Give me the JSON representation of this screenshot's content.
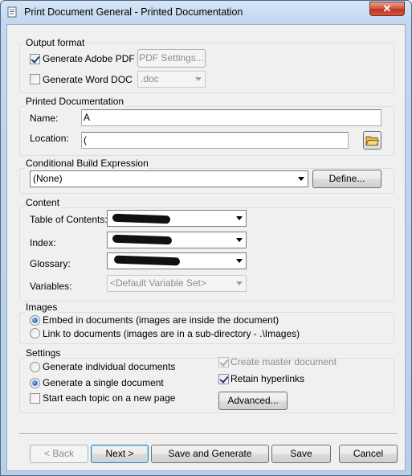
{
  "window": {
    "title": "Print Document General - Printed Documentation",
    "close_glyph": "✕"
  },
  "output_format": {
    "legend": "Output format",
    "generate_pdf_label": "Generate Adobe PDF",
    "generate_pdf_checked": true,
    "pdf_settings_label": "PDF Settings...",
    "generate_word_label": "Generate Word DOC",
    "generate_word_checked": false,
    "word_format_value": ".doc"
  },
  "printed_documentation": {
    "legend": "Printed Documentation",
    "name_label": "Name:",
    "name_value": "A",
    "location_label": "Location:",
    "location_value": "("
  },
  "conditional_build": {
    "legend": "Conditional Build Expression",
    "expression_value": "(None)",
    "define_label": "Define..."
  },
  "content": {
    "legend": "Content",
    "toc_label": "Table of Contents:",
    "toc_value": "",
    "index_label": "Index:",
    "index_value": "",
    "glossary_label": "Glossary:",
    "glossary_value": "",
    "variables_label": "Variables:",
    "variables_value": "<Default Variable Set>"
  },
  "images": {
    "legend": "Images",
    "embed_label": "Embed in documents (images are inside the document)",
    "link_label": "Link to documents (images are in a sub-directory - .\\Images)",
    "selected": "embed"
  },
  "settings": {
    "legend": "Settings",
    "individual_label": "Generate individual documents",
    "single_label": "Generate a single document",
    "selected": "single",
    "new_page_label": "Start each topic on a new page",
    "new_page_checked": false,
    "master_doc_label": "Create master document",
    "master_doc_checked": true,
    "retain_links_label": "Retain hyperlinks",
    "retain_links_checked": true,
    "advanced_label": "Advanced..."
  },
  "footer": {
    "back_label": "< Back",
    "next_label": "Next >",
    "save_generate_label": "Save and Generate",
    "save_label": "Save",
    "cancel_label": "Cancel"
  },
  "icons": {
    "title": "document-icon",
    "folder": "open-folder-icon"
  }
}
